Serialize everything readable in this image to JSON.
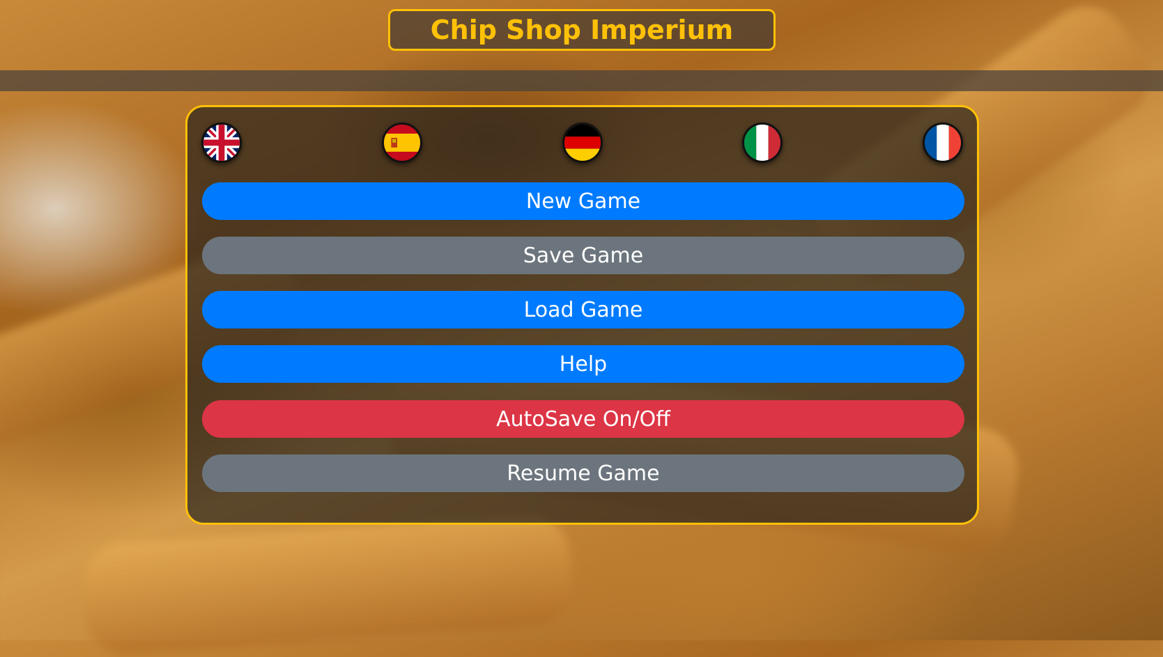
{
  "title": "Chip Shop Imperium",
  "languages": [
    {
      "code": "en",
      "flag": "uk-flag-icon"
    },
    {
      "code": "es",
      "flag": "spain-flag-icon"
    },
    {
      "code": "de",
      "flag": "germany-flag-icon"
    },
    {
      "code": "it",
      "flag": "italy-flag-icon"
    },
    {
      "code": "fr",
      "flag": "france-flag-icon"
    }
  ],
  "menu": {
    "new_game": "New Game",
    "save_game": "Save Game",
    "load_game": "Load Game",
    "help": "Help",
    "autosave": "AutoSave On/Off",
    "resume_game": "Resume Game"
  },
  "colors": {
    "accent": "#ffc107",
    "primary": "#007bff",
    "secondary": "#6c757d",
    "danger": "#dc3545"
  }
}
